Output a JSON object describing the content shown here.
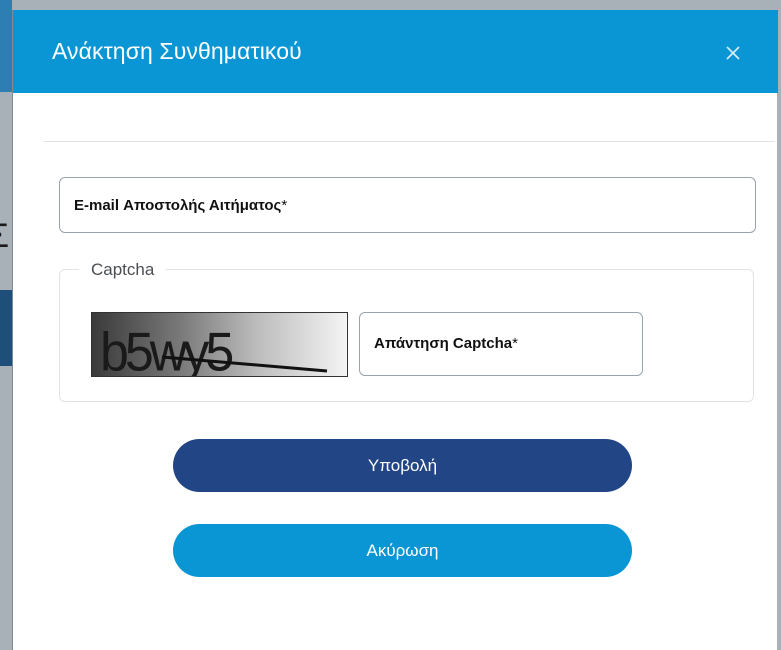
{
  "modal": {
    "title": "Ανάκτηση Συνθηματικού",
    "close_icon": "close-icon"
  },
  "background": {
    "partial_glyph": "Σ"
  },
  "form": {
    "email_label": "E-mail Αποστολής Αιτήματος",
    "required_mark": "*",
    "captcha_legend": "Captcha",
    "captcha_text": "b5wy5",
    "captcha_answer_label": "Απάντηση Captcha",
    "submit_label": "Υποβολή",
    "cancel_label": "Ακύρωση"
  },
  "colors": {
    "header": "#0a96d4",
    "submit": "#224586",
    "cancel": "#0a96d4"
  }
}
